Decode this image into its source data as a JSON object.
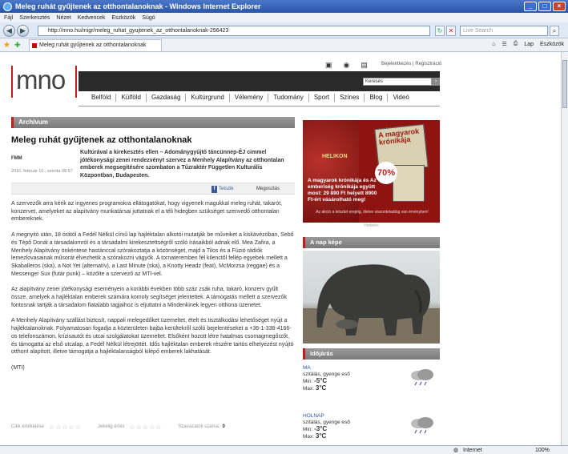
{
  "window": {
    "title": "Meleg ruhát gyűjtenek az otthontalanoknak - Windows Internet Explorer"
  },
  "menu": [
    "Fájl",
    "Szerkesztés",
    "Nézet",
    "Kedvencek",
    "Eszközök",
    "Súgó"
  ],
  "address": {
    "url": "http://mno.hu/migr/meleg_ruhat_gyujtenek_az_otthontalanoknak-256423",
    "search_placeholder": "Live Search"
  },
  "tab": {
    "title": "Meleg ruhát gyűjtenek az otthontalanoknak"
  },
  "toolbar": {
    "page": "Lap",
    "tools": "Eszközök"
  },
  "site": {
    "logo": "mno",
    "links": "Bejelentkezés | Regisztráció",
    "search_placeholder": "Keresés",
    "nav": [
      "Belföld",
      "Külföld",
      "Gazdaság",
      "Kultúrgrund",
      "Vélemény",
      "Tudomány",
      "Sport",
      "Színes",
      "Blog",
      "Videó"
    ]
  },
  "article": {
    "section": "Archívum",
    "title": "Meleg ruhát gyűjtenek az otthontalanoknak",
    "source": "FMM",
    "date": "2010. február 10., szerda 08:57",
    "lead": "Kultúrával a kirekesztés ellen – Adománygyűjtő táncünnep-ÉJ cimmel jótékonysági zenei rendezvényt szervez a Menhely Alapítvány az otthontalan emberek megsegítésére szombaton a Tűzraktér Független Kulturális Központban, Budapesten.",
    "share_fb": "Tetszik",
    "share_label": "Megosztás",
    "paragraphs": [
      "A szervezők arra kérik az ingyenes programokra ellátogatókat, hogy vigyenek magukkal meleg ruhát, takarót, konzervet, amelyeket az alapítvány munkatársai juttatnak el a téli hideg­ben szükséget szenvedő otthontalan embereknek.",
      "A megnyitó után, 18 órától a Fedél Nélkül című lap hajléktalan alkotói mutatják be műveiket a kiskávézóban, Sebő és Tépő Donát a társadalomról és a társadalmi kirekesztettségről szóló írásaikból adnak elő. Mea Zafira, a Menhely Alapítvány önkéntese hastánccal szórakoztatja a közönséget, majd a Tilos és a Fúzió rádiók lemezlovasainak műsorát élvezhetik a szórakozni vágyók. A tornateremben fél kilenctől fellép egyebek mellett a Skaballeros (ska), a Not Yet (alternatív), a Last Minute (ska), a Knotty Headz (feat), McMorzsa (reggae) és a Messenger Sux (futár punk) – közölte a szervező az MTI-vel.",
      "Az alapítvány zenei jótékonysági eseményein a korábbi években több száz zsák ruha, takaró, konzerv gyűlt össze, amelyek a hajléktalan emberek számára komoly segítséget jelentettek. A támogatás mellett a szervezők fontosnak tartják a társadalom fiatalabb tagjaihoz is eljuttatni a Mindenkinek legyen otthona üzenetet.",
      "A Menhely Alapítvány szállást biztosít, nappali melegedőket üzemeltet, ételt és tisztálkodási lehetőséget nyújt a hajléktalanoknak. Folyamatosan fogadja a közterületen bajba került­ekről szóló bejelentéseket a +36-1-338-4166-os telefonszámon, krízisautót és utcai szolgálatokat üzemeltet. Elsőként hozott létre hatalmas csomagmegőrzőt, és támogatta az első utcalap, a Fedél Nélkül létrejöttét. Idős hajléktalan emberek részére tartós elhelyezést nyújtó otthont alapított, illetve támogatja a hajléktalanságból kilépő emberek lakhatását.",
      "(MTI)"
    ],
    "ratings": {
      "label1": "Cikk értékelése",
      "label2": "Jekelig értés",
      "label3": "Szavazatok száma:",
      "count": "0"
    }
  },
  "ad": {
    "publisher": "HELIKON",
    "book": "A magyarok krónikája",
    "text": "A magyarok krónikája és Az emberiség krónikája együtt most: 29 890 Ft helyett 8900 Ft-ért vásárolható meg!",
    "badge": "70%",
    "foot": "Az akció a készlet erejéig, illetve viszonteladóig van érvényben!",
    "caption": "Hirdetés"
  },
  "side": {
    "photo_title": "A nap képe",
    "weather_title": "Időjárás"
  },
  "weather": [
    {
      "day": "MA",
      "cond": "szitálás, gyenge eső",
      "min_label": "Min:",
      "min": "-5°C",
      "max_label": "Max:",
      "max": "3°C"
    },
    {
      "day": "HOLNAP",
      "cond": "szitálás, gyenge eső",
      "min_label": "Min:",
      "min": "-3°C",
      "max_label": "Max:",
      "max": "3°C"
    }
  ],
  "status": {
    "zone": "Internet",
    "zoom": "100%"
  }
}
